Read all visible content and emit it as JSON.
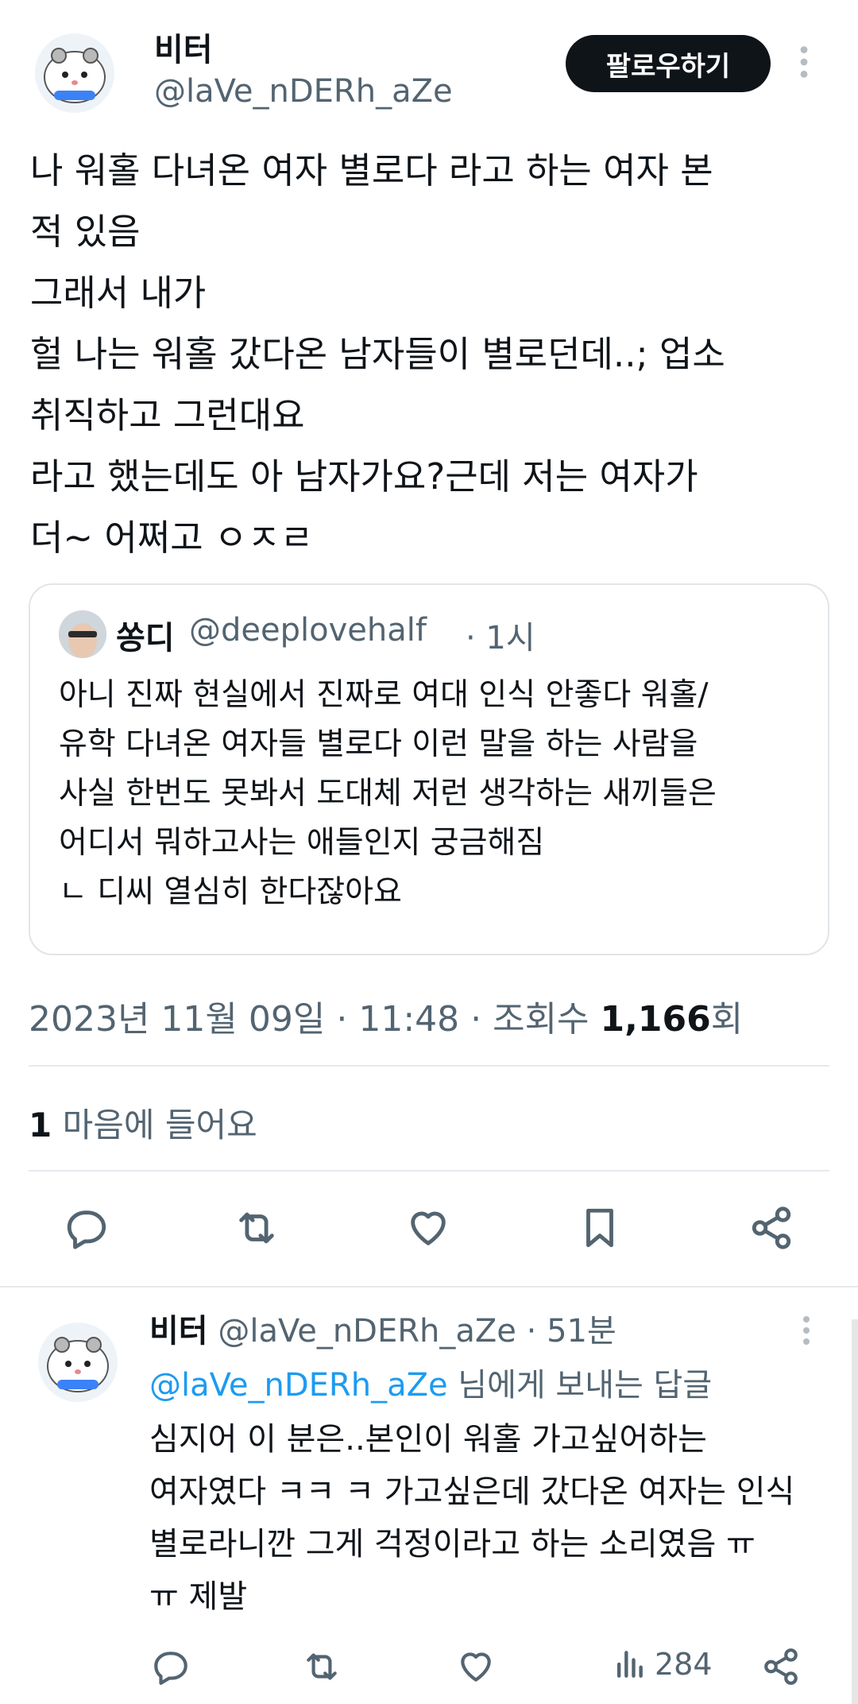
{
  "main_tweet": {
    "author_name": "비터",
    "author_handle": "@laVe_nDERh_aZe",
    "follow_label": "팔로우하기",
    "text": "나 워홀 다녀온 여자 별로다 라고 하는 여자 본\n적 있음\n그래서 내가\n헐 나는 워홀 갔다온 남자들이 별로던데..; 업소\n취직하고 그런대요\n라고 했는데도 아 남자가요?근데 저는 여자가\n더~ 어쩌고 ㅇㅈㄹ",
    "timestamp_prefix": "2023년 11월 09일 · 11:48 · 조회수 ",
    "view_count": "1,166",
    "view_suffix": "회",
    "like_count": "1",
    "like_label": "마음에 들어요"
  },
  "quote": {
    "author_name": "쏭디",
    "author_handle": "@deeplovehalf",
    "time": "· 1시",
    "text": "아니 진짜 현실에서 진짜로 여대 인식 안좋다 워홀/\n유학 다녀온 여자들 별로다 이런 말을 하는 사람을\n사실 한번도 못봐서 도대체 저런 생각하는 새끼들은\n어디서 뭐하고사는 애들인지 궁금해짐\nㄴ 디씨 열심히 한다잖아요"
  },
  "reply": {
    "author_name": "비터",
    "author_handle": "@laVe_nDERh_aZe",
    "time": "· 51분",
    "replying_to_handle": "@laVe_nDERh_aZe",
    "replying_to_suffix": " 님에게 보내는 답글",
    "text": "심지어 이 분은..본인이 워홀 가고싶어하는\n여자였다 ㅋㅋ ㅋ 가고싶은데 갔다온 여자는 인식\n별로라니깐 그게 걱정이라고 하는 소리였음 ㅠ\nㅠ 제발",
    "views": "284"
  },
  "icons": {
    "reply": "reply-icon",
    "retweet": "retweet-icon",
    "like": "heart-icon",
    "bookmark": "bookmark-icon",
    "share": "share-icon",
    "views": "views-icon",
    "more": "more-vertical-icon"
  },
  "colors": {
    "text": "#0f1419",
    "secondary": "#536471",
    "link": "#1d9bf0",
    "follow_bg": "#0f1419"
  }
}
